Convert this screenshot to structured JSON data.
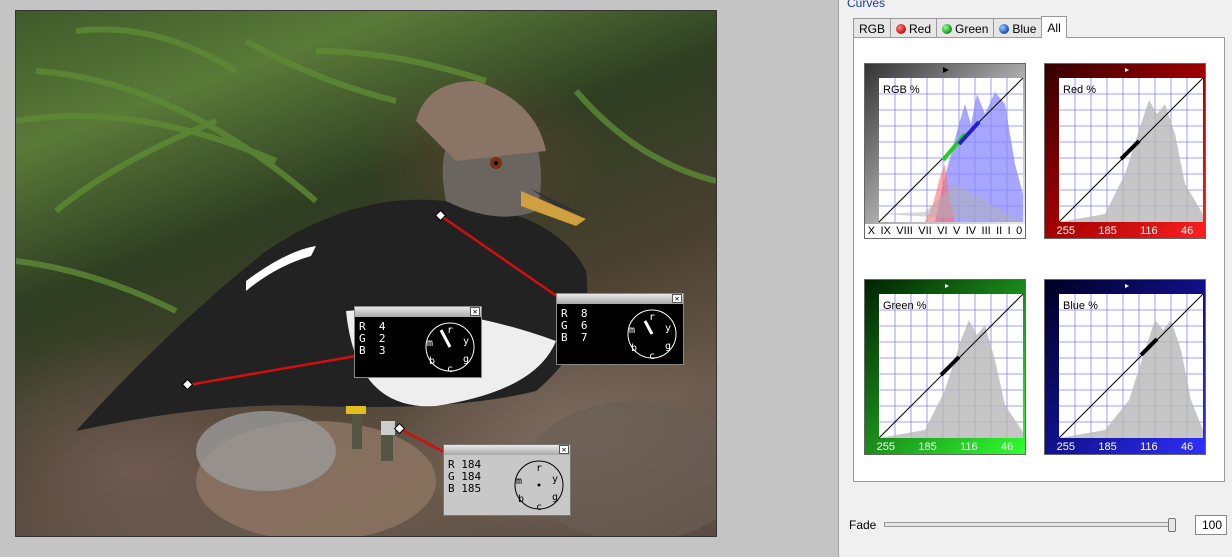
{
  "panel": {
    "title": "Curves"
  },
  "tabs": [
    {
      "label": "RGB",
      "dot": null,
      "active": false
    },
    {
      "label": "Red",
      "dot": "#cc2020",
      "active": false
    },
    {
      "label": "Green",
      "dot": "#22a022",
      "active": false
    },
    {
      "label": "Blue",
      "dot": "#2a5fc0",
      "active": false
    },
    {
      "label": "All",
      "dot": null,
      "active": true
    }
  ],
  "curves": {
    "rgb": {
      "label": "RGB %",
      "ticks": [
        "X",
        "IX",
        "VIII",
        "VII",
        "VI",
        "V",
        "IV",
        "III",
        "II",
        "I",
        "0"
      ]
    },
    "red": {
      "label": "Red %",
      "ticks": [
        "255",
        "185",
        "116",
        "46"
      ]
    },
    "green": {
      "label": "Green %",
      "ticks": [
        "255",
        "185",
        "116",
        "46"
      ]
    },
    "blue": {
      "label": "Blue %",
      "ticks": [
        "255",
        "185",
        "116",
        "46"
      ]
    }
  },
  "fade": {
    "label": "Fade",
    "value": "100",
    "level": 1.0
  },
  "samplers": [
    {
      "r": "4",
      "g": "2",
      "b": "3"
    },
    {
      "r": "8",
      "g": "6",
      "b": "7"
    },
    {
      "r": "184",
      "g": "184",
      "b": "185"
    }
  ],
  "dial_letters": {
    "r": "r",
    "y": "y",
    "g": "g",
    "c": "c",
    "b": "b",
    "m": "m"
  },
  "colors": {
    "red_bg": "#a00000",
    "green_bg": "#1a8a1a",
    "blue_bg": "#10108a",
    "curve_line": "#000000",
    "grid": "#4a4ae0",
    "histogram": "#b8b8d0"
  }
}
